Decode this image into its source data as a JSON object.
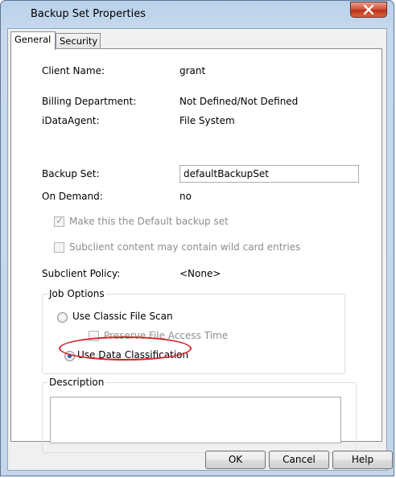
{
  "window": {
    "title": "Backup Set Properties"
  },
  "tabs": [
    {
      "label": "General",
      "active": true
    },
    {
      "label": "Security",
      "active": false
    }
  ],
  "fields": {
    "client_name": {
      "label": "Client Name:",
      "value": "grant"
    },
    "billing_department": {
      "label": "Billing Department:",
      "value": "Not Defined/Not Defined"
    },
    "idataagent": {
      "label": "iDataAgent:",
      "value": "File System"
    },
    "backup_set": {
      "label": "Backup Set:",
      "value": "defaultBackupSet"
    },
    "on_demand": {
      "label": "On Demand:",
      "value": "no"
    },
    "subclient_policy": {
      "label": "Subclient Policy:",
      "value": "<None>"
    }
  },
  "checkboxes": {
    "default_backup_set": {
      "label": "Make this the Default backup set",
      "checked": true,
      "disabled": true
    },
    "wild_card": {
      "label": "Subclient content may contain wild card entries",
      "checked": false,
      "disabled": true
    },
    "preserve_access_time": {
      "label": "Preserve File Access Time",
      "checked": false,
      "disabled": true
    }
  },
  "job_options": {
    "title": "Job Options",
    "classic_scan": {
      "label": "Use Classic File Scan",
      "selected": false
    },
    "data_classification": {
      "label": "Use Data Classification",
      "selected": true
    }
  },
  "description": {
    "title": "Description",
    "value": ""
  },
  "buttons": {
    "ok": "OK",
    "cancel": "Cancel",
    "help": "Help"
  },
  "colors": {
    "highlight": "#d3242a",
    "close_button": "#c94a33",
    "title_bar": "#b9d1ea"
  }
}
